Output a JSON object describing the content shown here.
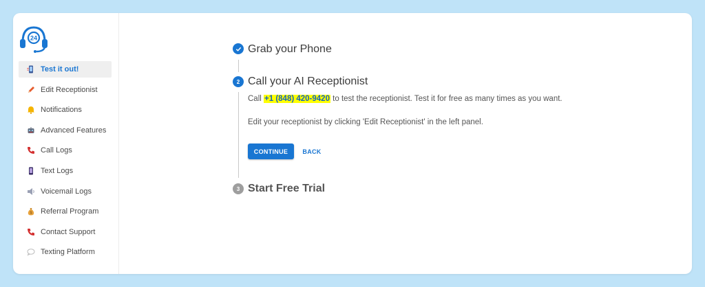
{
  "sidebar": {
    "logo_text": "24",
    "items": [
      {
        "label": "Test it out!",
        "icon": "phone-device-icon",
        "color": "#1976d2"
      },
      {
        "label": "Edit Receptionist",
        "icon": "pencil-icon",
        "color": "#e65c2e"
      },
      {
        "label": "Notifications",
        "icon": "bell-icon",
        "color": "#f5b400"
      },
      {
        "label": "Advanced Features",
        "icon": "robot-icon",
        "color": "#555555"
      },
      {
        "label": "Call Logs",
        "icon": "phone-icon",
        "color": "#d32f2f"
      },
      {
        "label": "Text Logs",
        "icon": "mobile-icon",
        "color": "#5c3d99"
      },
      {
        "label": "Voicemail Logs",
        "icon": "speaker-icon",
        "color": "#9aa0b4"
      },
      {
        "label": "Referral Program",
        "icon": "money-bag-icon",
        "color": "#e8a33d"
      },
      {
        "label": "Contact Support",
        "icon": "phone-icon",
        "color": "#d32f2f"
      },
      {
        "label": "Texting Platform",
        "icon": "chat-bubble-icon",
        "color": "#bdbdbd"
      }
    ]
  },
  "steps": {
    "step1": {
      "title": "Grab your Phone",
      "icon": "check-icon"
    },
    "step2": {
      "number": "2",
      "title": "Call your AI Receptionist",
      "text_before": "Call ",
      "phone": "+1 (848) 420-9420",
      "text_after": " to test the receptionist. Test it for free as many times as you want.",
      "line2": "Edit your receptionist by clicking 'Edit Receptionist' in the left panel.",
      "continue_label": "CONTINUE",
      "back_label": "BACK"
    },
    "step3": {
      "number": "3",
      "title": "Start Free Trial"
    }
  },
  "colors": {
    "accent": "#1976d2",
    "highlight": "#ffff00",
    "background": "#bfe3f8"
  }
}
